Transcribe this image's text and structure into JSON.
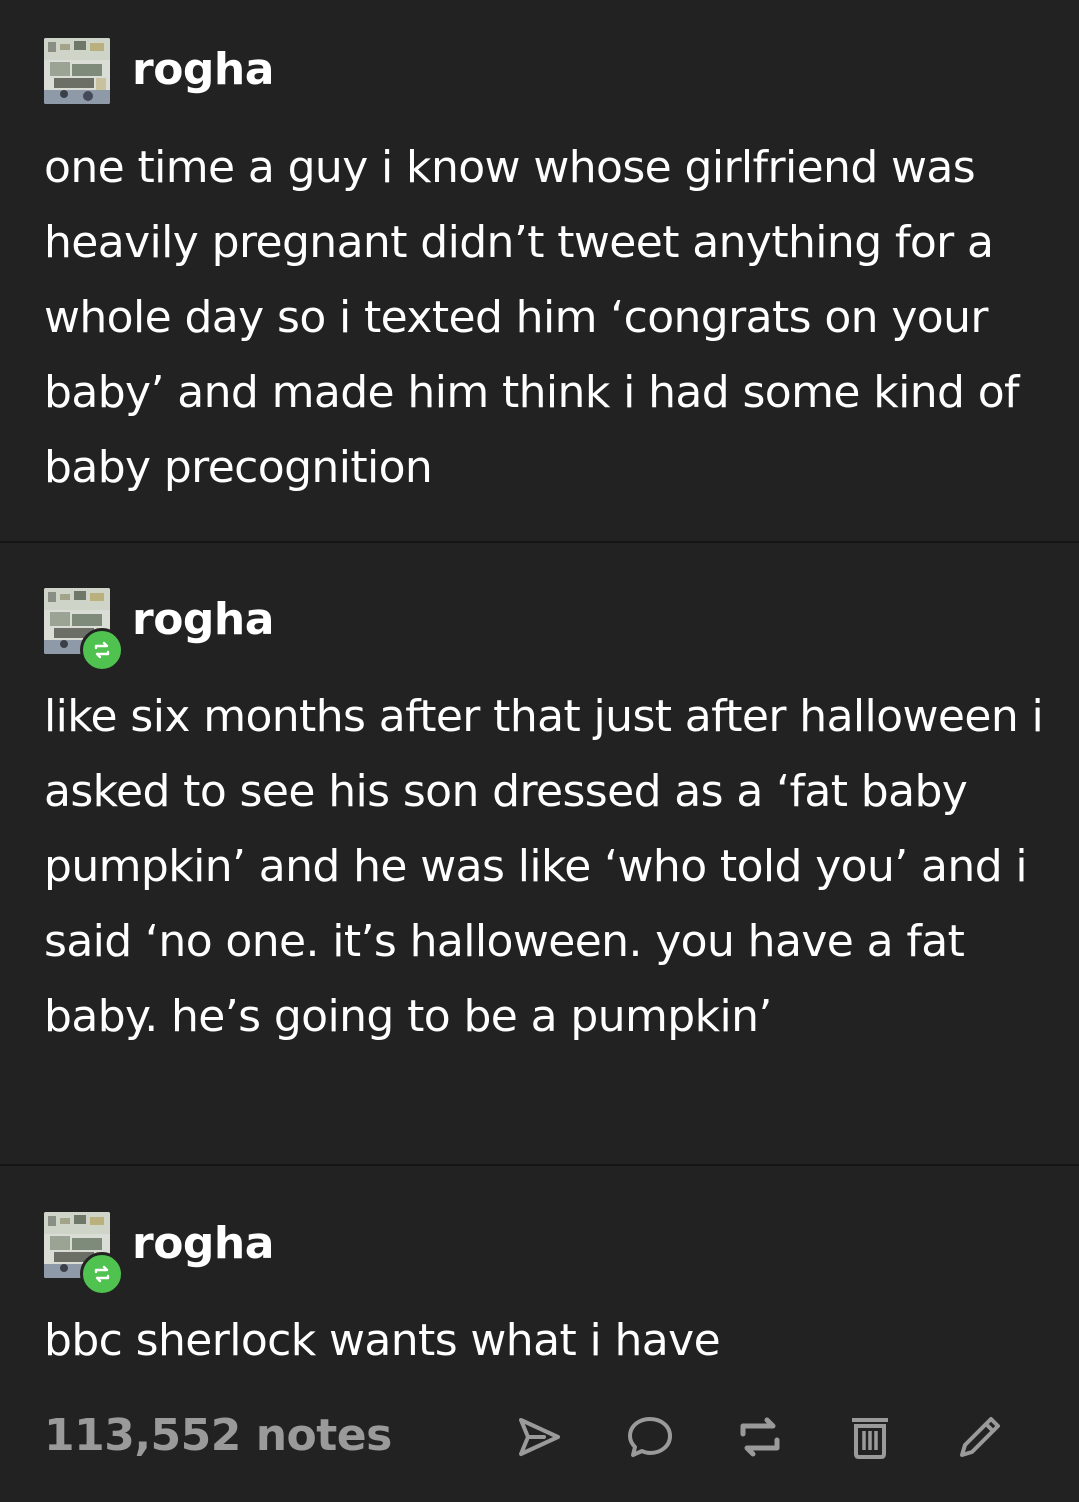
{
  "posts": [
    {
      "username": "rogha",
      "text": "one time a guy i know whose girlfriend was heavily pregnant didn’t tweet anything for a whole day so i texted him ‘congrats on your baby’ and made him think i had some kind of baby precognition",
      "is_reblog": false
    },
    {
      "username": "rogha",
      "text": "like six months after that just after halloween i asked to see his son dressed as a ‘fat baby pumpkin’ and he was like ‘who told you’ and i said ‘no one. it’s halloween. you have a fat baby. he’s going to be a pumpkin’",
      "is_reblog": true
    },
    {
      "username": "rogha",
      "text": "bbc sherlock wants what i have",
      "is_reblog": true
    }
  ],
  "footer": {
    "notes": "113,552 notes",
    "actions": [
      {
        "name": "share",
        "icon": "paper-plane-icon"
      },
      {
        "name": "reply",
        "icon": "speech-bubble-icon"
      },
      {
        "name": "reblog",
        "icon": "reblog-icon"
      },
      {
        "name": "delete",
        "icon": "trash-icon"
      },
      {
        "name": "edit",
        "icon": "pencil-icon"
      }
    ]
  },
  "colors": {
    "background": "#222222",
    "text": "#ffffff",
    "muted": "#9a9a9a",
    "reblog_green": "#4fc24f"
  }
}
